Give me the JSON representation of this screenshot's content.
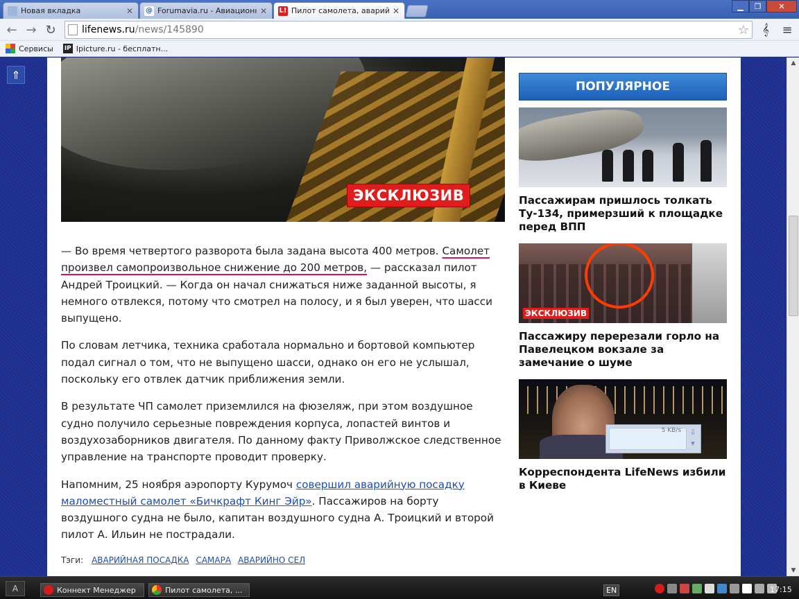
{
  "browser": {
    "tabs": [
      {
        "title": "Новая вкладка",
        "favicon_text": "",
        "favicon_color": "#9db6da",
        "active": false
      },
      {
        "title": "Forumavia.ru - Авиационны",
        "favicon_text": "@",
        "favicon_color": "#2b5bb8",
        "active": false
      },
      {
        "title": "Пилот самолета, аварийно",
        "favicon_text": "L!",
        "favicon_color": "#e01c1c",
        "active": true
      }
    ],
    "url_host": "lifenews.ru",
    "url_path": "/news/145890",
    "bookmarks": [
      {
        "label": "Сервисы",
        "icon": "apps-grid-icon"
      },
      {
        "label": "Ipicture.ru - бесплатн...",
        "icon": "ipicture-icon",
        "icon_text": "IP"
      }
    ]
  },
  "article": {
    "exclusive_badge": "ЭКСКЛЮЗИВ",
    "p1_a": "— Во время четвертого разворота была задана высота 400 метров. ",
    "p1_marked": "Самолет произвел самопроизвольное снижение до 200 метров,",
    "p1_b": " — рассказал пилот Андрей Троицкий. — Когда он начал снижаться ниже заданной высоты, я немного отвлекся, потому что смотрел на полосу, и я был уверен, что шасси выпущено.",
    "p2": "По словам летчика, техника сработала нормально и бортовой компьютер подал сигнал о том, что не выпущено шасси, однако он его не услышал, поскольку его отвлек датчик приближения земли.",
    "p3": "В результате ЧП самолет приземлился на фюзеляж, при этом воздушное судно получило серьезные повреждения корпуса, лопастей винтов и воздухозаборников двигателя. По данному факту Приволжское следственное управление на транспорте проводит проверку.",
    "p4_a": "Напомним, 25 ноября аэропорту Курумоч ",
    "p4_link": "совершил аварийную посадку маломестный самолет «Бичкрафт Кинг Эйр»",
    "p4_b": ". Пассажиров на борту воздушного судна не было, капитан воздушного судна А. Троицкий и второй пилот А. Ильин не пострадали.",
    "tags_label": "Тэги:",
    "tags": [
      "АВАРИЙНАЯ ПОСАДКА",
      "САМАРА",
      "АВАРИЙНО СЕЛ"
    ]
  },
  "sidebar": {
    "header": "ПОПУЛЯРНОЕ",
    "items": [
      {
        "title": "Пассажирам пришлось толкать Ту-134, примерзший к площадке перед ВПП"
      },
      {
        "title": "Пассажиру перерезали горло на Павелецком вокзале за замечание о шуме",
        "badge": "ЭКСКЛЮЗИВ"
      },
      {
        "title": "Корреспондента LifeNews избили в Киеве"
      }
    ]
  },
  "download_widget": {
    "speed": "5 KB/s"
  },
  "taskbar": {
    "start_label": "A",
    "items": [
      {
        "label": "Коннект Менеджер",
        "icon_color": "#d41c1c"
      },
      {
        "label": "Пилот самолета, ...",
        "icon_color": "#3d8a2e"
      }
    ],
    "language": "EN",
    "clock": "17:15"
  },
  "colors": {
    "accent_blue": "#1d5fb8",
    "exclusive_red": "#e01c1c",
    "link": "#1c4fb5",
    "underline_marker": "#e0114a"
  }
}
